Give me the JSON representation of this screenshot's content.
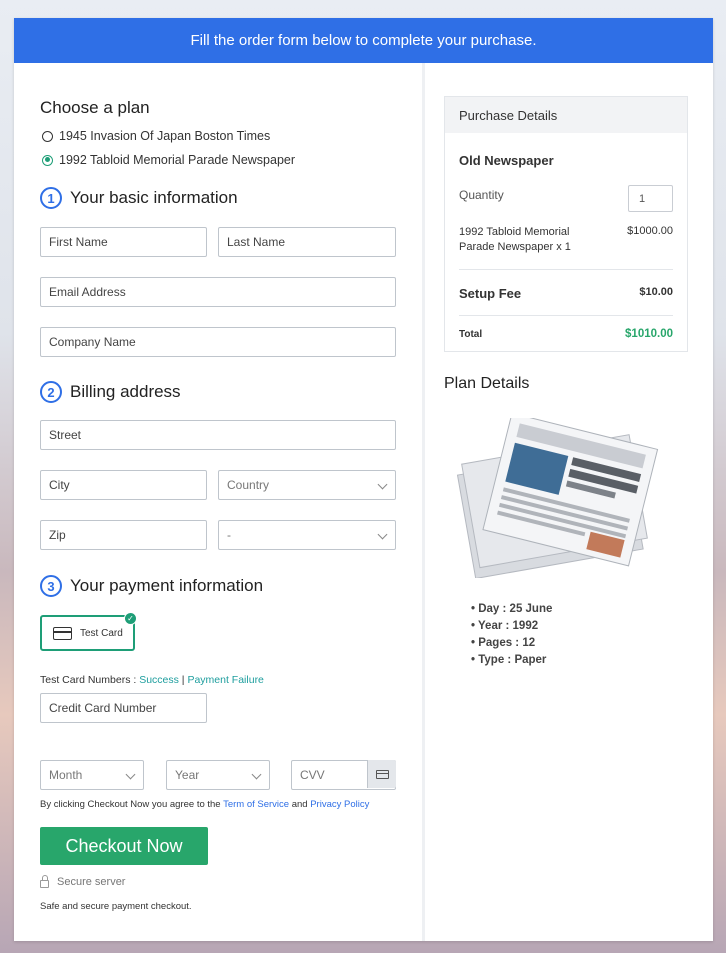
{
  "banner": "Fill the order form below to complete your purchase.",
  "plan": {
    "heading": "Choose a plan",
    "options": [
      {
        "label": "1945 Invasion Of Japan Boston Times",
        "selected": false
      },
      {
        "label": "1992 Tabloid Memorial Parade Newspaper",
        "selected": true
      }
    ]
  },
  "basic": {
    "number": "1",
    "heading": "Your basic information",
    "first_name": "First Name",
    "last_name": "Last Name",
    "email": "Email Address",
    "company": "Company Name"
  },
  "billing": {
    "number": "2",
    "heading": "Billing address",
    "street": "Street",
    "city": "City",
    "country": "Country",
    "zip": "Zip",
    "state": "-"
  },
  "payment": {
    "number": "3",
    "heading": "Your payment information",
    "card_option": "Test Card",
    "test_numbers_prefix": "Test Card Numbers : ",
    "success": "Success",
    "separator": " | ",
    "failure": "Payment Failure",
    "card_number": "Credit Card Number",
    "month": "Month",
    "year": "Year",
    "cvv": "CVV"
  },
  "agreement": {
    "prefix": "By clicking Checkout Now you agree to the ",
    "terms": "Term of Service",
    "and": " and ",
    "privacy": "Privacy Policy"
  },
  "checkout_label": "Checkout Now",
  "secure_label": "Secure server",
  "safe_label": "Safe and secure payment checkout.",
  "purchase": {
    "heading": "Purchase Details",
    "product": "Old Newspaper",
    "quantity_label": "Quantity",
    "quantity_value": "1",
    "item_label": "1992 Tabloid Memorial Parade Newspaper x 1",
    "item_price": "$1000.00",
    "setup_label": "Setup Fee",
    "setup_price": "$10.00",
    "total_label": "Total",
    "total_price": "$1010.00"
  },
  "plan_details": {
    "heading": "Plan Details",
    "items": [
      "Day : 25 June",
      "Year : 1992",
      "Pages : 12",
      "Type : Paper"
    ]
  },
  "colors": {
    "accent": "#2f6fe6",
    "success": "#28a66b",
    "teal": "#1e9e77"
  }
}
